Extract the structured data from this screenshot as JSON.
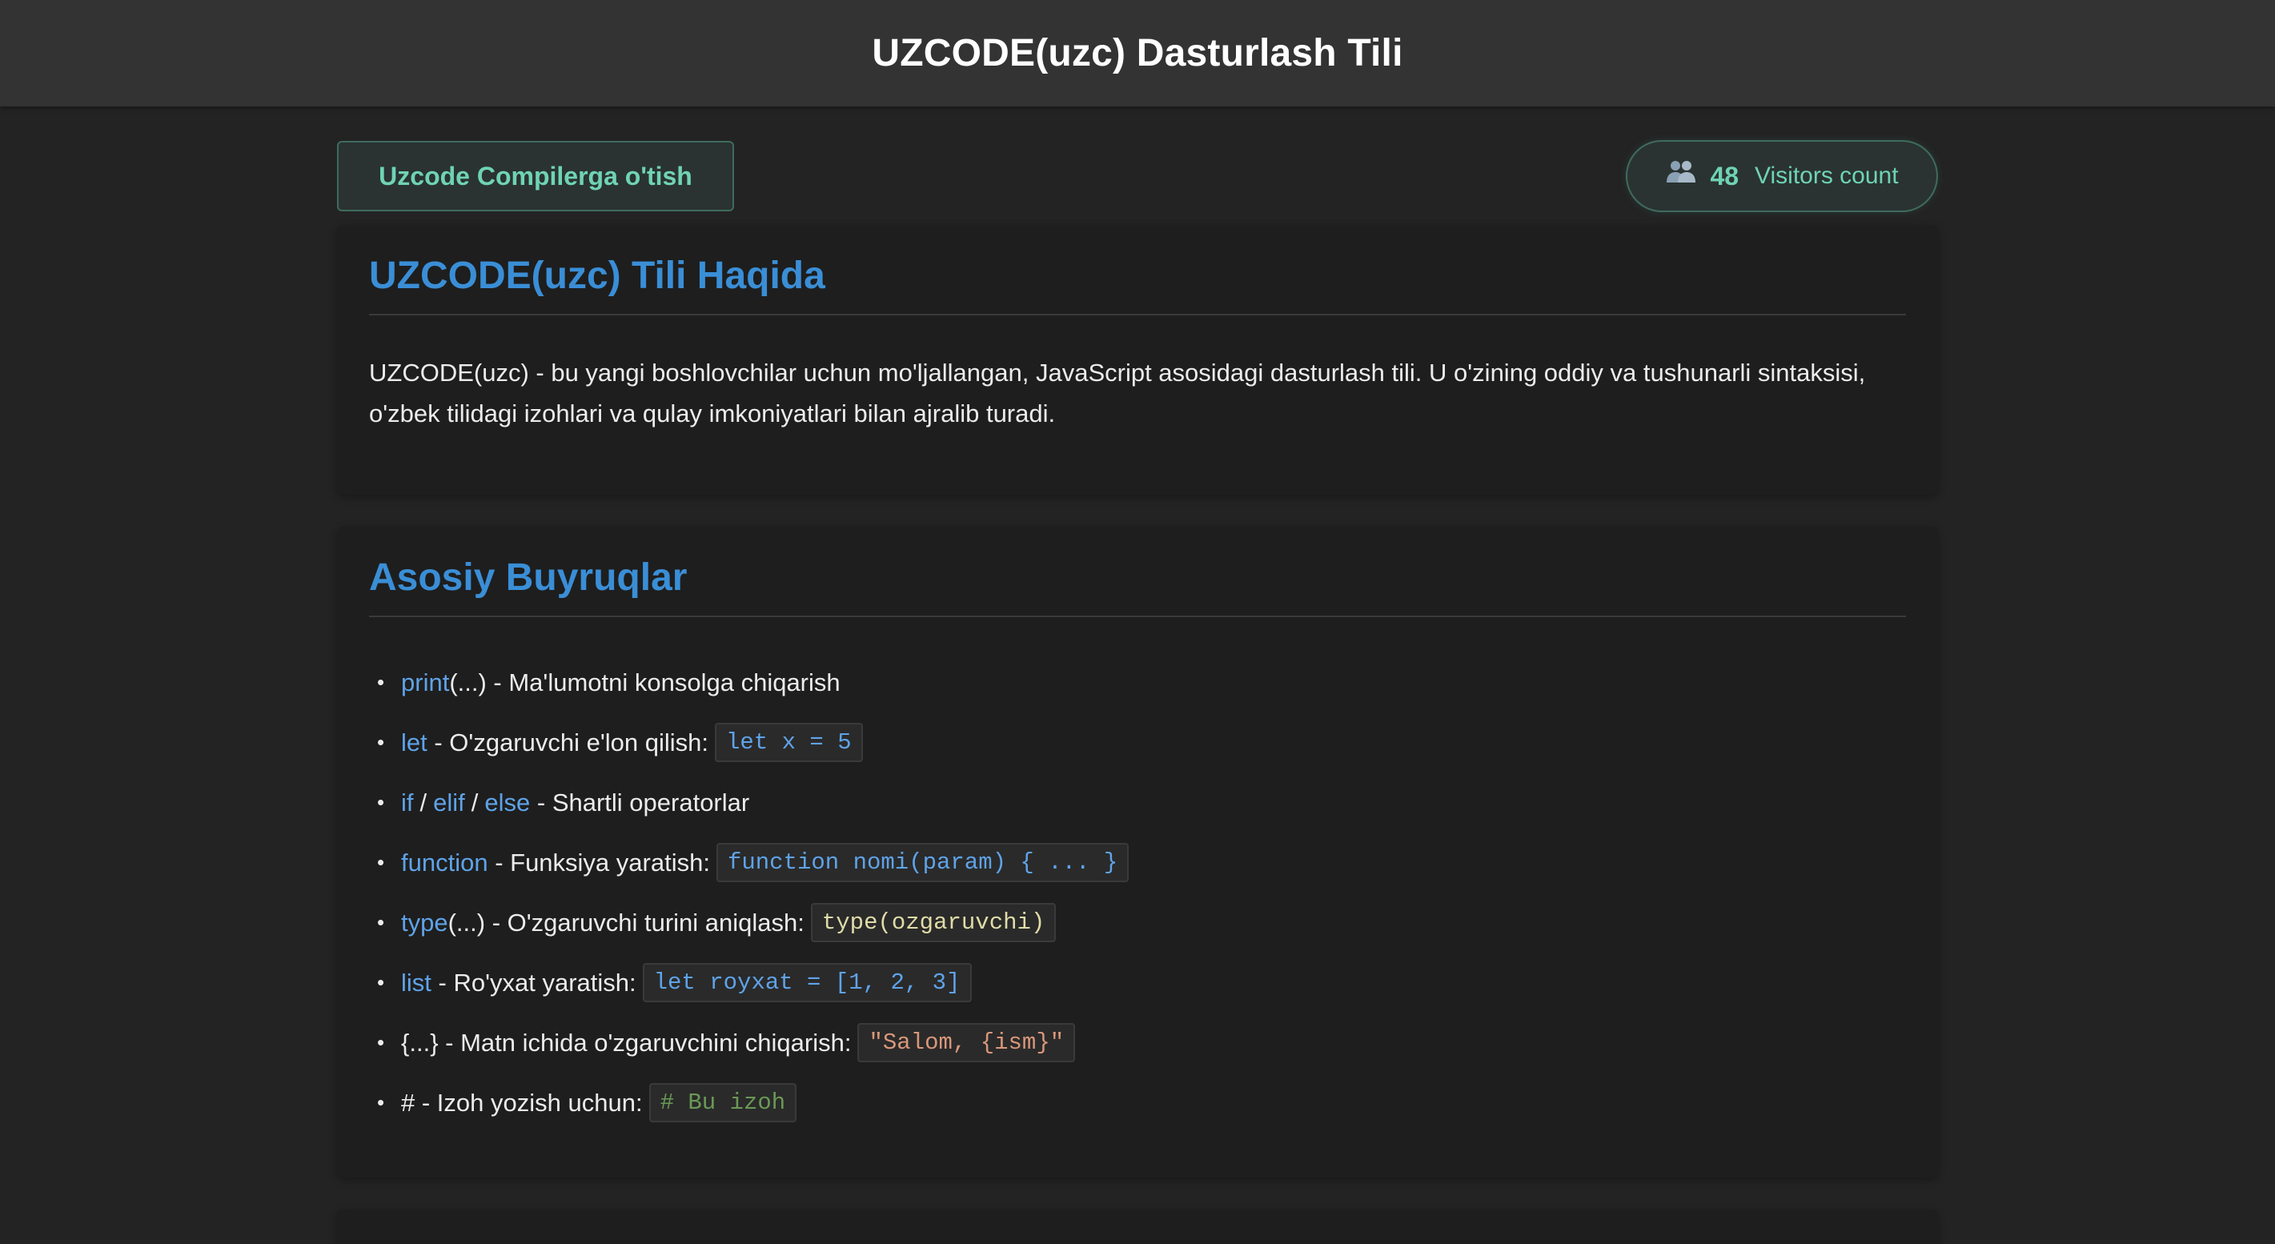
{
  "header": {
    "title": "UZCODE(uzc) Dasturlash Tili"
  },
  "actions": {
    "compiler_button": "Uzcode Compilerga o'tish",
    "visitors_count": "48",
    "visitors_label": "Visitors count"
  },
  "about": {
    "heading": "UZCODE(uzc) Tili Haqida",
    "text": "UZCODE(uzc) - bu yangi boshlovchilar uchun mo'ljallangan, JavaScript asosidagi dasturlash tili. U o'zining oddiy va tushunarli sintaksisi, o'zbek tilidagi izohlari va qulay imkoniyatlari bilan ajralib turadi."
  },
  "commands": {
    "heading": "Asosiy Buyruqlar",
    "items": [
      {
        "kw": "print",
        "text": "(...) - Ma'lumotni konsolga chiqarish"
      },
      {
        "kw": "let",
        "text": " - O'zgaruvchi e'lon qilish:",
        "code": "let x = 5"
      },
      {
        "kw1": "if",
        "sep1": "/",
        "kw2": "elif",
        "sep2": "/",
        "kw3": "else",
        "text": " - Shartli operatorlar"
      },
      {
        "kw": "function",
        "text": " - Funksiya yaratish:",
        "code": "function nomi(param) { ... }"
      },
      {
        "kw": "type",
        "text": "(...) - O'zgaruvchi turini aniqlash:",
        "code": "type(ozgaruvchi)"
      },
      {
        "kw": "list",
        "text": " - Ro'yxat yaratish:",
        "code": "let royxat = [1, 2, 3]"
      },
      {
        "text": "{...} - Matn ichida o'zgaruvchini chiqarish:",
        "code": "\"Salom, {ism}\""
      },
      {
        "text": "# - Izoh yozish uchun:",
        "code": "# Bu izoh"
      }
    ]
  },
  "colors": {
    "accent_blue": "#3a8ed6",
    "keyword_blue": "#5fa3e8",
    "teal": "#6fd3b4",
    "code_yellow": "#e0dca8",
    "code_orange": "#d9977a",
    "code_green": "#6a9955"
  },
  "icons": {
    "visitors": "users-icon"
  }
}
